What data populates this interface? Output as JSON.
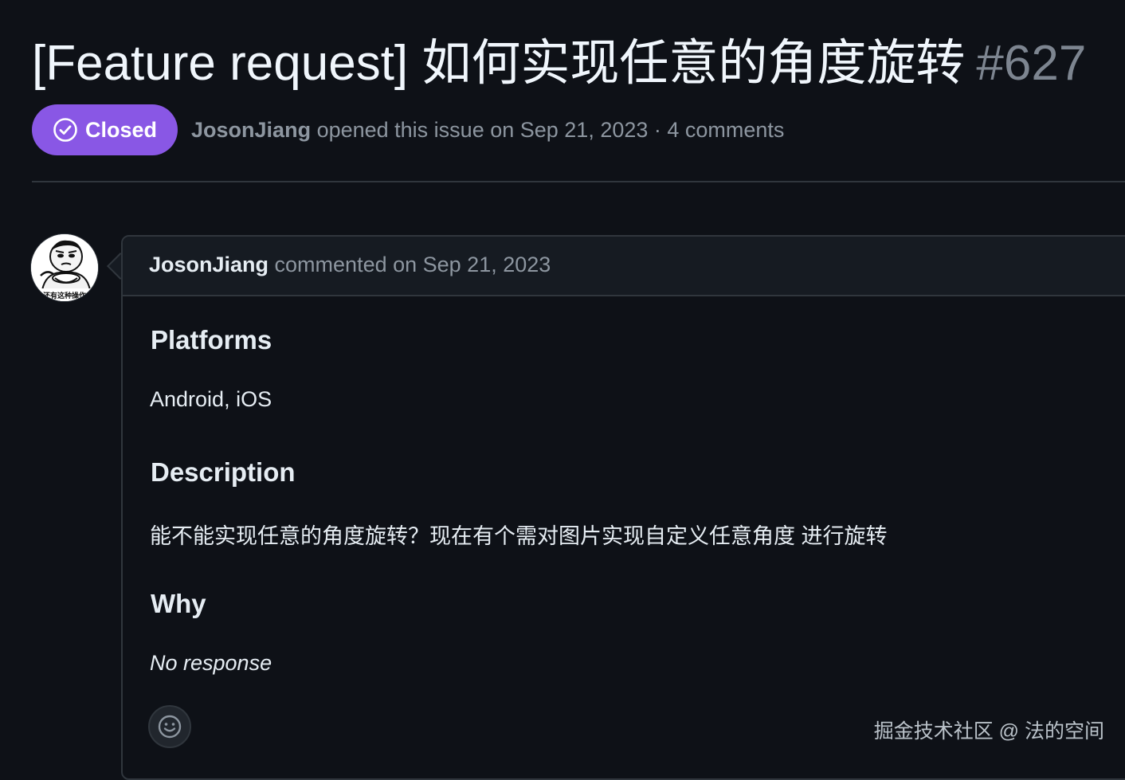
{
  "issue": {
    "title": "[Feature request] 如何实现任意的角度旋转",
    "number": "#627",
    "state": "Closed",
    "state_color": "#8957e5",
    "state_icon": "check-circle-icon",
    "author": "JosonJiang",
    "meta_suffix": " opened this issue on Sep 21, 2023 · 4 comments"
  },
  "comment": {
    "author": "JosonJiang",
    "header_suffix": " commented on Sep 21, 2023",
    "avatar_icon": "avatar-meme-icon",
    "avatar_caption": "还有这种操作",
    "sections": [
      {
        "heading": "Platforms",
        "body": "Android, iOS"
      },
      {
        "heading": "Description",
        "body": "能不能实现任意的角度旋转？现在有个需对图片实现自定义任意角度 进行旋转"
      },
      {
        "heading": "Why",
        "body": "No response"
      }
    ],
    "reaction_icon": "smiley-icon"
  },
  "watermark": "掘金技术社区 @ 法的空间"
}
